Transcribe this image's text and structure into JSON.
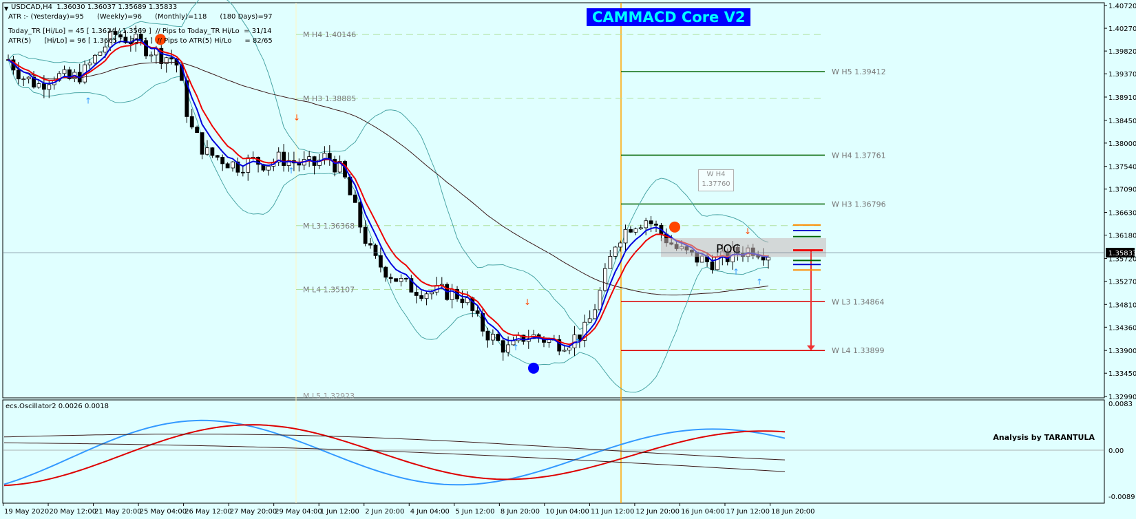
{
  "header": {
    "symbol_line": "USDCAD,H4  1.36030 1.36037 1.35689 1.35833",
    "atr_line": "ATR :- (Yesterday)=95      (Weekly)=96      (Monthly)=118      (180 Days)=97",
    "today_line": "Today_TR [Hi/Lo] = 45 [ 1.3614 / 1.3569 ]  // Pips to Today_TR Hi/Lo  = 31/14",
    "atr5_line": "ATR(5)      [Hi/Lo] = 96 [ 1.3665 / 1.3571 ]  // Pips to ATR(5) Hi/Lo      = 82/65"
  },
  "logo_text": "CAMMACD Core V2",
  "indicator_label": "ecs.Oscillator2 0.0026 0.0018",
  "byline": "Analysis by TARANTULA",
  "tag_box": {
    "line1": "W  H4",
    "line2": "1.37760"
  },
  "colors": {
    "background": "#e0ffff",
    "up_candle": "#ffffff",
    "down_candle": "#000000",
    "ma_fast": "#0000dd",
    "ma_slow": "#ee0000",
    "bands": "#4aa6a6",
    "long_ma": "#3a1a1a",
    "vline": "#ffa500",
    "osc_blue": "#3399ff",
    "osc_red": "#dd0000"
  },
  "chart_data": {
    "type": "candlestick",
    "symbol": "USDCAD",
    "timeframe": "H4",
    "y_range": [
      1.3299,
      1.4072
    ],
    "y_ticks": [
      1.4072,
      1.4027,
      1.3982,
      1.3937,
      1.3891,
      1.3845,
      1.38,
      1.3754,
      1.3709,
      1.3663,
      1.3618,
      1.3572,
      1.3527,
      1.3481,
      1.3436,
      1.339,
      1.3345,
      1.3299
    ],
    "current_price": "1.35833",
    "x_labels": [
      "19 May 2020",
      "20 May 12:00",
      "21 May 20:00",
      "25 May 04:00",
      "26 May 12:00",
      "27 May 20:00",
      "29 May 04:00",
      "1 Jun 12:00",
      "2 Jun 20:00",
      "4 Jun 04:00",
      "5 Jun 12:00",
      "8 Jun 20:00",
      "10 Jun 04:00",
      "11 Jun 12:00",
      "12 Jun 20:00",
      "16 Jun 04:00",
      "17 Jun 12:00",
      "18 Jun 20:00"
    ],
    "close_path": [
      1.3965,
      1.393,
      1.3915,
      1.3935,
      1.3925,
      1.394,
      1.398,
      1.4015,
      1.4005,
      1.399,
      1.3975,
      1.3965,
      1.383,
      1.378,
      1.377,
      1.3755,
      1.3765,
      1.376,
      1.377,
      1.376,
      1.3755,
      1.3775,
      1.374,
      1.365,
      1.357,
      1.3545,
      1.352,
      1.351,
      1.3505,
      1.3505,
      1.3495,
      1.344,
      1.341,
      1.339,
      1.342,
      1.3415,
      1.3405,
      1.341,
      1.343,
      1.351,
      1.361,
      1.364,
      1.365,
      1.362,
      1.359,
      1.3575,
      1.3565,
      1.357,
      1.3585,
      1.3592,
      1.3583
    ],
    "pivot_lines": [
      {
        "label": "M  H4 1.40146",
        "value": 1.40146,
        "style": "dashed"
      },
      {
        "label": "M  H3 1.38885",
        "value": 1.38885,
        "style": "dashed"
      },
      {
        "label": "M  L3 1.36368",
        "value": 1.36368,
        "style": "dashed"
      },
      {
        "label": "M  L4 1.35107",
        "value": 1.35107,
        "style": "dashed"
      },
      {
        "label": "M  L5 1.32923",
        "value": 1.32923,
        "style": "dashed"
      },
      {
        "label": "W  H5 1.39412",
        "value": 1.39412,
        "style": "green"
      },
      {
        "label": "W  H4 1.37761",
        "value": 1.37761,
        "style": "green"
      },
      {
        "label": "W  H3 1.36796",
        "value": 1.36796,
        "style": "green"
      },
      {
        "label": "W  L3 1.34864",
        "value": 1.34864,
        "style": "red"
      },
      {
        "label": "W  L4 1.33899",
        "value": 1.33899,
        "style": "red"
      }
    ],
    "poc_label": "POC",
    "oscillator": {
      "label": "ecs.Oscillator2 0.0026 0.0018",
      "y_ticks": [
        "0.0083",
        "0.00",
        "-0.0089"
      ],
      "y_range": [
        -0.0089,
        0.0083
      ]
    }
  }
}
